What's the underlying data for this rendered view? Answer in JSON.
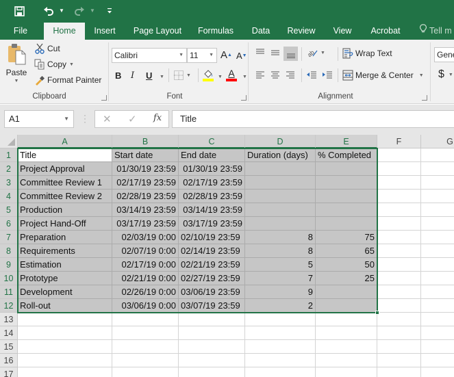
{
  "quick_access": {
    "save_icon": "save-icon",
    "undo_icon": "undo-icon",
    "redo_icon": "redo-icon",
    "customize_icon": "customize-qat-icon"
  },
  "tabs": [
    {
      "label": "File"
    },
    {
      "label": "Home",
      "active": true
    },
    {
      "label": "Insert"
    },
    {
      "label": "Page Layout"
    },
    {
      "label": "Formulas"
    },
    {
      "label": "Data"
    },
    {
      "label": "Review"
    },
    {
      "label": "View"
    },
    {
      "label": "Acrobat"
    }
  ],
  "tell_me": "Tell m",
  "ribbon": {
    "clipboard": {
      "label": "Clipboard",
      "paste": "Paste",
      "cut": "Cut",
      "copy": "Copy",
      "format_painter": "Format Painter"
    },
    "font": {
      "label": "Font",
      "font_name": "Calibri",
      "font_size": "11",
      "bold": "B",
      "italic": "I",
      "underline": "U",
      "increase_font": "A",
      "decrease_font": "A",
      "font_color_letter": "A",
      "fill_color": "#ffff00",
      "font_color": "#ff0000"
    },
    "alignment": {
      "label": "Alignment",
      "wrap_text": "Wrap Text",
      "merge_center": "Merge & Center"
    },
    "number": {
      "format": "Gene",
      "currency": "$"
    }
  },
  "formula_bar": {
    "name_box": "A1",
    "cancel": "✕",
    "enter": "✓",
    "fx": "fx",
    "content": "Title"
  },
  "sheet": {
    "columns": [
      "A",
      "B",
      "C",
      "D",
      "E",
      "F",
      "G"
    ],
    "row_numbers": [
      "1",
      "2",
      "3",
      "4",
      "5",
      "6",
      "7",
      "8",
      "9",
      "10",
      "11",
      "12",
      "13",
      "14",
      "15",
      "16",
      "17"
    ],
    "active_cell": "A1",
    "selection": "A1:E12",
    "headers": [
      "Title",
      "Start date",
      "End date",
      "Duration (days)",
      "% Completed"
    ],
    "rows": [
      [
        "Project Approval",
        "01/30/19 23:59",
        "01/30/19 23:59",
        "",
        ""
      ],
      [
        "Committee Review 1",
        "02/17/19 23:59",
        "02/17/19 23:59",
        "",
        ""
      ],
      [
        "Committee Review 2",
        "02/28/19 23:59",
        "02/28/19 23:59",
        "",
        ""
      ],
      [
        "Production",
        "03/14/19 23:59",
        "03/14/19 23:59",
        "",
        ""
      ],
      [
        "Project Hand-Off",
        "03/17/19 23:59",
        "03/17/19 23:59",
        "",
        ""
      ],
      [
        "Preparation",
        "02/03/19 0:00",
        "02/10/19 23:59",
        "8",
        "75"
      ],
      [
        "Requirements",
        "02/07/19 0:00",
        "02/14/19 23:59",
        "8",
        "65"
      ],
      [
        "Estimation",
        "02/17/19 0:00",
        "02/21/19 23:59",
        "5",
        "50"
      ],
      [
        "Prototype",
        "02/21/19 0:00",
        "02/27/19 23:59",
        "7",
        "25"
      ],
      [
        "Development",
        "02/26/19 0:00",
        "03/06/19 23:59",
        "9",
        ""
      ],
      [
        "Roll-out",
        "03/06/19 0:00",
        "03/07/19 23:59",
        "2",
        ""
      ]
    ]
  },
  "colors": {
    "brand": "#217346",
    "selection_fill": "#c6c6c6"
  }
}
